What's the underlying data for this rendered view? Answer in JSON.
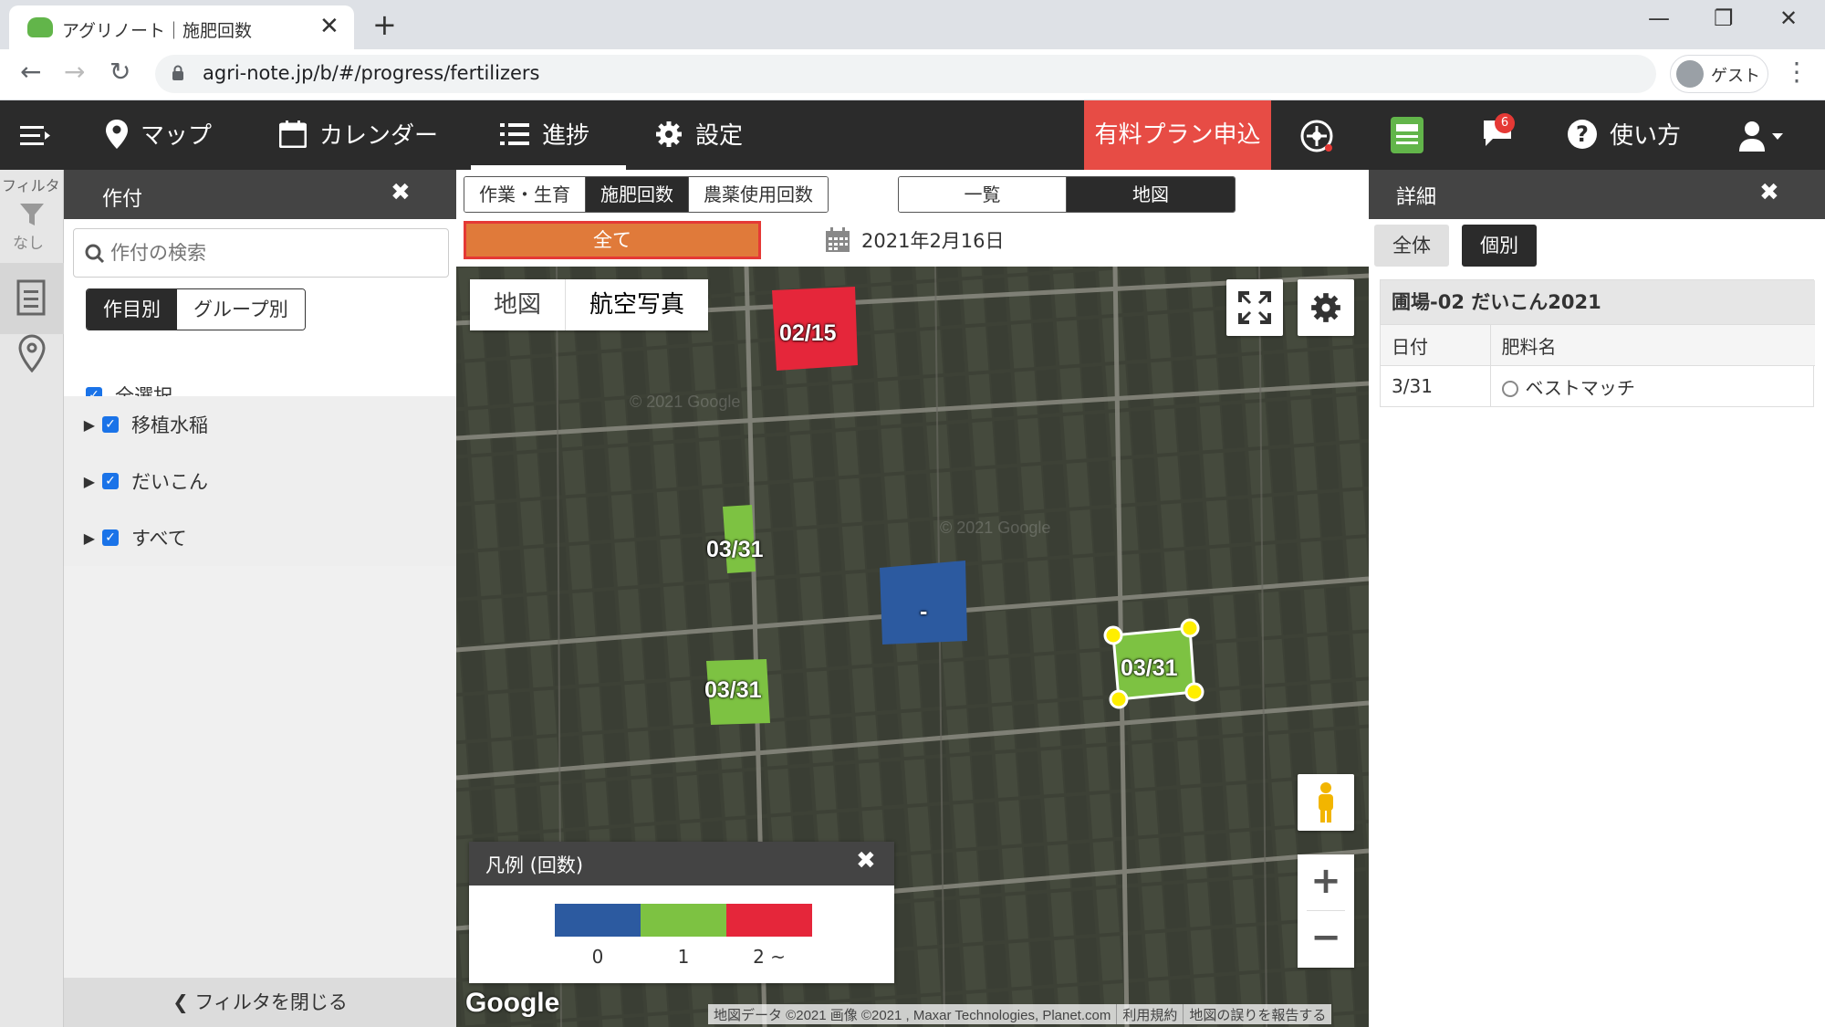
{
  "browser": {
    "tab_title": "アグリノート｜施肥回数",
    "tab_close": "✕",
    "new_tab": "+",
    "window_minimize": "—",
    "window_restore": "❐",
    "window_close": "✕",
    "back": "←",
    "forward": "→",
    "reload": "↻",
    "url": "agri-note.jp/b/#/progress/fertilizers",
    "profile_label": "ゲスト",
    "menu": "⋮"
  },
  "appnav": {
    "items": [
      {
        "label": "マップ",
        "icon": "map-pin-icon"
      },
      {
        "label": "カレンダー",
        "icon": "calendar-icon"
      },
      {
        "label": "進捗",
        "icon": "list-icon"
      },
      {
        "label": "設定",
        "icon": "gear-icon"
      }
    ],
    "paid_plan": "有料プラン申込",
    "notifications_count": "6",
    "help_label": "使い方",
    "help_icon": "?"
  },
  "rail": {
    "filter_label": "フィルタ",
    "filter_state": "なし"
  },
  "filter_panel": {
    "title": "作付",
    "close": "✖",
    "search_placeholder": "作付の検索",
    "group_tabs": [
      "作目別",
      "グループ別"
    ],
    "select_all": "全選択",
    "items": [
      "移植水稲",
      "だいこん",
      "すべて"
    ],
    "close_filter": "フィルタを閉じる"
  },
  "center": {
    "tabs": [
      "作業・生育",
      "施肥回数",
      "農薬使用回数"
    ],
    "active_tab": "施肥回数",
    "view_tabs": [
      "一覧",
      "地図"
    ],
    "active_view": "地図",
    "all_button": "全て",
    "date": "2021年2月16日"
  },
  "map": {
    "map_types": [
      "地図",
      "航空写真"
    ],
    "fields": [
      {
        "label": "02/15",
        "color": "#e5263a"
      },
      {
        "label": "03/31",
        "color": "#7dc242"
      },
      {
        "label": "-",
        "color": "#2c5aa0"
      },
      {
        "label": "03/31",
        "color": "#7dc242"
      },
      {
        "label": "03/31",
        "color": "#7dc242"
      }
    ],
    "watermark": "© 2021 Google",
    "legend": {
      "title": "凡例 (回数)",
      "close": "✖",
      "items": [
        {
          "label": "0",
          "color": "#2c5aa0"
        },
        {
          "label": "1",
          "color": "#7dc242"
        },
        {
          "label": "2 ~",
          "color": "#e5263a"
        }
      ]
    },
    "google_logo": "Google",
    "attribution": [
      "地図データ ©2021 画像 ©2021 , Maxar Technologies, Planet.com",
      "利用規約",
      "地図の誤りを報告する"
    ],
    "zoom_in": "+",
    "zoom_out": "−"
  },
  "detail_panel": {
    "title": "詳細",
    "close": "✖",
    "tabs": [
      "全体",
      "個別"
    ],
    "active_tab": "個別",
    "card_title": "圃場-02 だいこん2021",
    "columns": [
      "日付",
      "肥料名"
    ],
    "rows": [
      {
        "date": "3/31",
        "fertilizer": "ベストマッチ"
      }
    ]
  }
}
